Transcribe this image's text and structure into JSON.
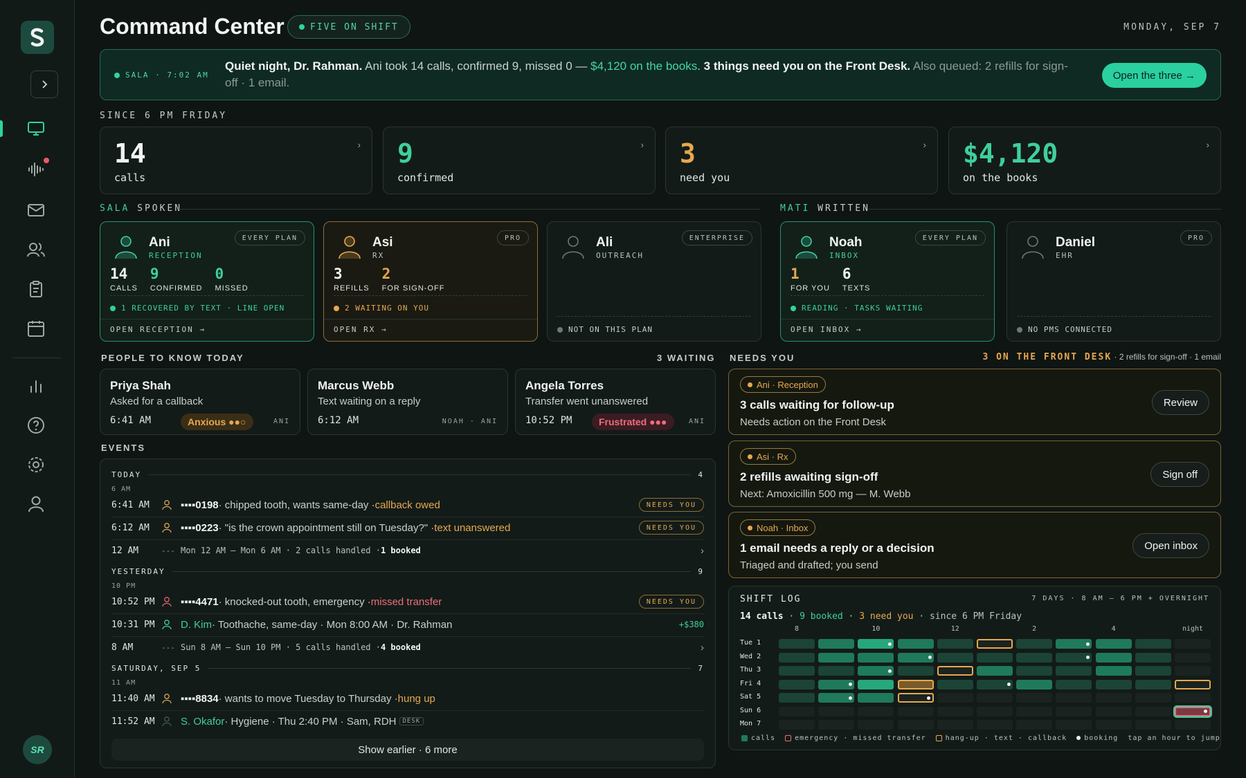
{
  "header": {
    "title": "Command Center",
    "shift_pill": "FIVE ON SHIFT",
    "date": "MONDAY, SEP 7"
  },
  "banner": {
    "tag": "SALA · 7:02 AM",
    "greeting": "Quiet night, Dr. Rahman.",
    "summary": " Ani took 14 calls, confirmed 9, missed 0 — ",
    "amount": "$4,120 on the books",
    "dot": ". ",
    "need": "3 things need you on the Front Desk.",
    "queued": " Also queued: 2 refills for sign-off · 1 email.",
    "button": "Open the three →"
  },
  "since_label": "SINCE 6 PM FRIDAY",
  "kpis": [
    {
      "value": "14",
      "label": "calls",
      "color": "#f0f4f2"
    },
    {
      "value": "9",
      "label": "confirmed",
      "color": "#3fcf9c"
    },
    {
      "value": "3",
      "label": "need you",
      "color": "#e7a84f"
    },
    {
      "value": "$4,120",
      "label": "on the books",
      "color": "#3fcf9c"
    }
  ],
  "sections": {
    "sala": "SALA",
    "spoken": "SPOKEN",
    "mati": "MATI",
    "written": "WRITTEN",
    "people": "PEOPLE TO KNOW TODAY",
    "people_count": "3 WAITING",
    "events": "EVENTS",
    "needs": "NEEDS YOU",
    "needs_count": "3 ON THE FRONT DESK",
    "needs_extra": " · 2 refills for sign-off · 1 email"
  },
  "agents": {
    "ani": {
      "name": "Ani",
      "role": "RECEPTION",
      "plan": "EVERY PLAN",
      "s1n": "14",
      "s1l": "CALLS",
      "s2n": "9",
      "s2l": "CONFIRMED",
      "s3n": "0",
      "s3l": "MISSED",
      "status": "1 RECOVERED BY TEXT · LINE OPEN",
      "foot": "OPEN RECEPTION →"
    },
    "asi": {
      "name": "Asi",
      "role": "RX",
      "plan": "PRO",
      "s1n": "3",
      "s1l": "REFILLS",
      "s2n": "2",
      "s2l": "FOR SIGN-OFF",
      "status": "2 WAITING ON YOU",
      "foot": "OPEN RX →"
    },
    "ali": {
      "name": "Ali",
      "role": "OUTREACH",
      "plan": "ENTERPRISE",
      "status": "NOT ON THIS PLAN"
    },
    "noah": {
      "name": "Noah",
      "role": "INBOX",
      "plan": "EVERY PLAN",
      "s1n": "1",
      "s1l": "FOR YOU",
      "s2n": "6",
      "s2l": "TEXTS",
      "status": "READING · TASKS WAITING",
      "foot": "OPEN INBOX →"
    },
    "daniel": {
      "name": "Daniel",
      "role": "EHR",
      "plan": "PRO",
      "status": "NO PMS CONNECTED"
    }
  },
  "people": [
    {
      "name": "Priya Shah",
      "desc": "Asked for a callback",
      "time": "6:41 AM",
      "mood": "Anxious ●●○",
      "meta": "ANI"
    },
    {
      "name": "Marcus Webb",
      "desc": "Text waiting on a reply",
      "time": "6:12 AM",
      "mood": "",
      "meta": "NOAH · ANI"
    },
    {
      "name": "Angela Torres",
      "desc": "Transfer went unanswered",
      "time": "10:52 PM",
      "mood": "Frustrated ●●●",
      "meta": "ANI"
    }
  ],
  "events": {
    "today": {
      "label": "TODAY",
      "count": "4",
      "sub": "6 AM"
    },
    "e1": {
      "time": "6:41 AM",
      "id": "▪▪▪▪0198",
      "desc": " · chipped tooth, wants same-day · ",
      "flag": "callback owed",
      "badge": "NEEDS YOU"
    },
    "e2": {
      "time": "6:12 AM",
      "id": "▪▪▪▪0223",
      "desc": " · \"is the crown appointment still on Tuesday?\" · ",
      "flag": "text unanswered",
      "badge": "NEEDS YOU"
    },
    "e3": {
      "time": "12 AM",
      "desc": "Mon 12 AM – Mon 6 AM · 2 calls handled · ",
      "bold": "1 booked"
    },
    "yesterday": {
      "label": "YESTERDAY",
      "count": "9",
      "sub": "10 PM"
    },
    "e4": {
      "time": "10:52 PM",
      "id": "▪▪▪▪4471",
      "desc": " · knocked-out tooth, emergency · ",
      "flag": "missed transfer",
      "badge": "NEEDS YOU"
    },
    "e5": {
      "time": "10:31 PM",
      "id": "D. Kim",
      "desc": " · Toothache, same-day · Mon 8:00 AM · Dr. Rahman",
      "amount": "+$380"
    },
    "e6": {
      "time": "8 AM",
      "desc": "Sun 8 AM – Sun 10 PM · 5 calls handled · ",
      "bold": "4 booked"
    },
    "saturday": {
      "label": "SATURDAY, SEP 5",
      "count": "7",
      "sub": "11 AM"
    },
    "e7": {
      "time": "11:40 AM",
      "id": "▪▪▪▪8834",
      "desc": " · wants to move Tuesday to Thursday · ",
      "flag": "hung up"
    },
    "e8": {
      "time": "11:52 AM",
      "id": "S. Okafor",
      "desc": " · Hygiene · Thu 2:40 PM · Sam, RDH ",
      "badge": "DESK"
    },
    "show_more": "Show earlier · 6 more"
  },
  "needs": [
    {
      "tag": "Ani · Reception",
      "title": "3 calls waiting for follow-up",
      "sub": "Needs action on the Front Desk",
      "button": "Review"
    },
    {
      "tag": "Asi · Rx",
      "title": "2 refills awaiting sign-off",
      "sub": "Next: Amoxicillin 500 mg — M. Webb",
      "button": "Sign off"
    },
    {
      "tag": "Noah · Inbox",
      "title": "1 email needs a reply or a decision",
      "sub": "Triaged and drafted; you send",
      "button": "Open inbox"
    }
  ],
  "shift_log": {
    "title": "SHIFT LOG",
    "range": "7 DAYS · 8 AM – 6 PM + OVERNIGHT",
    "calls": "14 calls",
    "booked": "9 booked",
    "need": "3 need you",
    "since": "since 6 PM Friday",
    "hours": [
      "8",
      "10",
      "12",
      "2",
      "4",
      "night"
    ],
    "days": [
      "Tue 1",
      "Wed 2",
      "Thu 3",
      "Fri 4",
      "Sat 5",
      "Sun 6",
      "Mon 7"
    ],
    "cells": [
      [
        "1",
        "2",
        "3b",
        "2",
        "1",
        "h",
        "1",
        "2b",
        "2",
        "1",
        "0"
      ],
      [
        "1",
        "2",
        "2",
        "2b",
        "1",
        "1",
        "1",
        "1b",
        "2",
        "1",
        "0"
      ],
      [
        "1",
        "1",
        "2b",
        "1",
        "h",
        "2",
        "1",
        "1",
        "2",
        "1",
        "0"
      ],
      [
        "1",
        "2b",
        "3",
        "hf",
        "1",
        "1b",
        "2",
        "1",
        "1",
        "1",
        "h"
      ],
      [
        "1",
        "2b",
        "2",
        "hb",
        "0",
        "0",
        "0",
        "0",
        "0",
        "0",
        "0"
      ],
      [
        "0",
        "0",
        "0",
        "0",
        "0",
        "0",
        "0",
        "0",
        "0",
        "0",
        "eb"
      ],
      [
        "0",
        "0",
        "0",
        "0",
        "0",
        "0",
        "0",
        "0",
        "0",
        "0",
        "0"
      ]
    ],
    "legend": {
      "calls": "calls",
      "emergency": "emergency · missed transfer",
      "hangup": "hang-up · text · callback",
      "booking": "booking",
      "hint": "tap an hour to jump"
    }
  }
}
